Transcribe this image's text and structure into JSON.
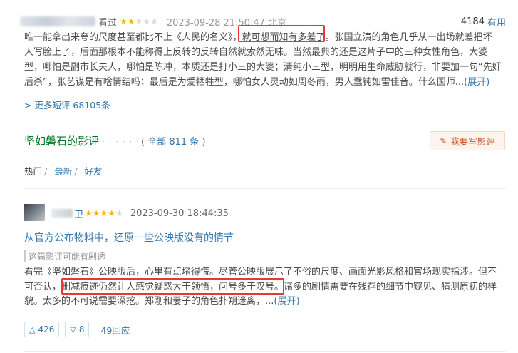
{
  "review1": {
    "watched_label": "看过",
    "rating_stars": 2,
    "max_stars": 5,
    "time": "2023-09-28 21:50:47 北京",
    "useful_count": "4184",
    "useful_label": "有用",
    "body_lines": [
      "唯一能拿出来夸的尺度甚至都比不上《人民的名义》，就可想而知有多差了。张国立演的角色几乎从一出场就差把坏",
      "人写脸上了，后面那根本不能称得上反转的反转自然就索然无味。当然最典的还是这片子中的三种女性角色，大婆",
      "型，哪怕是副市长夫人，哪怕是陈冲，本质还是打小三的大婆；清纯小三型，明明用生命威胁就行，非要加一句“先奸",
      "后杀”，张艺谋是有啥情结吗；最后是为爱牺牲型，哪怕女人灵动如周冬雨，男人蠢钝如雷佳音。什么国师..."
    ],
    "expand_label": "(展开)"
  },
  "more_short_reviews": "> 更多短评 68105条",
  "reviews_section": {
    "title": "坚如磐石的影评",
    "dots": "· · · · · ·",
    "all_prefix": "( ",
    "all_label": "全部 811 条",
    "all_suffix": " )",
    "write_label": "我要写影评"
  },
  "sort": {
    "hot": "热门",
    "latest": "最新",
    "friends": "好友",
    "sep": "/"
  },
  "review2": {
    "name_fragment": "卫",
    "rating_stars": 4,
    "max_stars": 5,
    "time": "2023-09-30 18:44:35",
    "title": "从官方公布物料中，还原一些公映版没有的情节",
    "spoiler": "这篇影评可能有剧透",
    "body_lines": [
      "看完《坚如磐石》公映版后，心里有点堵得慌。尽管公映版展示了不俗的尺度、画面光影风格和官场现实指涉。但不",
      "可否认，删减痕迹仍然让人感觉疑惑大于领悟，问号多于叹号。诸多的剧情需要在残存的细节中窥见、猜测原初的样",
      "貌。太多的不可说需要深挖。郑刚和妻子的角色扑朔迷离，..."
    ],
    "expand_label": "(展开)",
    "upvotes": "426",
    "downvotes": "8",
    "replies": "49回应"
  },
  "colors": {
    "link": "#3377aa",
    "section_green": "#007722",
    "star": "#f5b20a",
    "highlight_box": "#e53935"
  }
}
